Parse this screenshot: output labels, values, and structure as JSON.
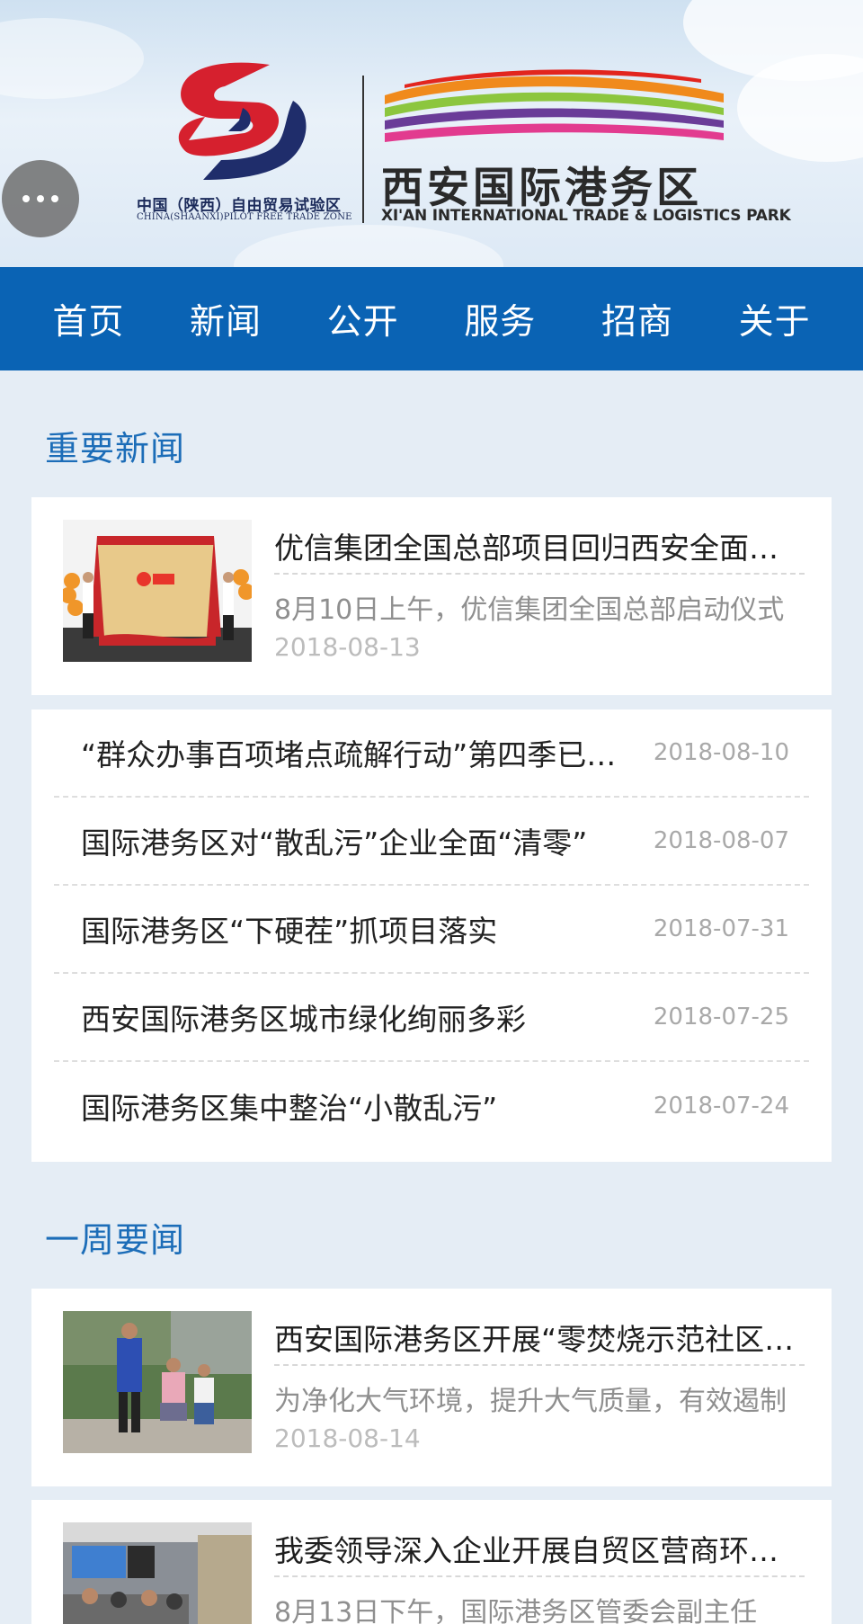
{
  "header": {
    "ftz_caption_cn": "中国（陕西）自由贸易试验区",
    "ftz_caption_en": "CHINA(SHAANXI)PILOT FREE TRADE ZONE",
    "park_name_cn": "西安国际港务区",
    "park_name_en": "XI'AN INTERNATIONAL TRADE & LOGISTICS PARK"
  },
  "nav": {
    "items": [
      "首页",
      "新闻",
      "公开",
      "服务",
      "招商",
      "关于"
    ]
  },
  "important_news": {
    "title": "重要新闻",
    "featured": {
      "title": "优信集团全国总部项目回归西安全面启动",
      "summary": "8月10日上午，优信集团全国总部启动仪式",
      "date": "2018-08-13"
    },
    "list": [
      {
        "title": "“群众办事百项堵点疏解行动”第四季已启动",
        "date": "2018-08-10"
      },
      {
        "title": "国际港务区对“散乱污”企业全面“清零”",
        "date": "2018-08-07"
      },
      {
        "title": "国际港务区“下硬茬”抓项目落实",
        "date": "2018-07-31"
      },
      {
        "title": "西安国际港务区城市绿化绚丽多彩",
        "date": "2018-07-25"
      },
      {
        "title": "国际港务区集中整治“小散乱污”",
        "date": "2018-07-24"
      }
    ]
  },
  "weekly_news": {
    "title": "一周要闻",
    "items": [
      {
        "title": "西安国际港务区开展“零焚烧示范社区”活动",
        "summary": "为净化大气环境，提升大气质量，有效遏制",
        "date": "2018-08-14"
      },
      {
        "title": "我委领导深入企业开展自贸区营商环境调研",
        "summary": "8月13日下午，国际港务区管委会副主任",
        "date": ""
      }
    ]
  },
  "colors": {
    "nav_bg": "#0a63b4",
    "section_title": "#1c6db8",
    "page_bg": "#e5edf5"
  }
}
